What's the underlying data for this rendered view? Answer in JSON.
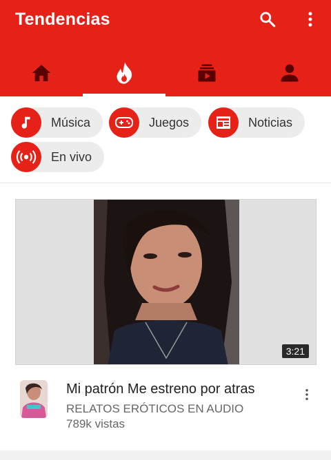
{
  "header": {
    "title": "Tendencias",
    "background": "#e62117"
  },
  "tabs": [
    {
      "name": "home",
      "icon": "home-icon",
      "active": false
    },
    {
      "name": "trending",
      "icon": "flame-icon",
      "active": true
    },
    {
      "name": "subscriptions",
      "icon": "subscriptions-icon",
      "active": false
    },
    {
      "name": "account",
      "icon": "person-icon",
      "active": false
    }
  ],
  "categories": [
    {
      "label": "Música",
      "icon": "music-note-icon"
    },
    {
      "label": "Juegos",
      "icon": "gamepad-icon"
    },
    {
      "label": "Noticias",
      "icon": "newspaper-icon"
    },
    {
      "label": "En vivo",
      "icon": "live-broadcast-icon"
    }
  ],
  "video": {
    "duration": "3:21",
    "title": "Mi patrón Me estreno por atras",
    "channel": "RELATOS ERÓTICOS EN AUDIO",
    "views": "789k vistas"
  }
}
